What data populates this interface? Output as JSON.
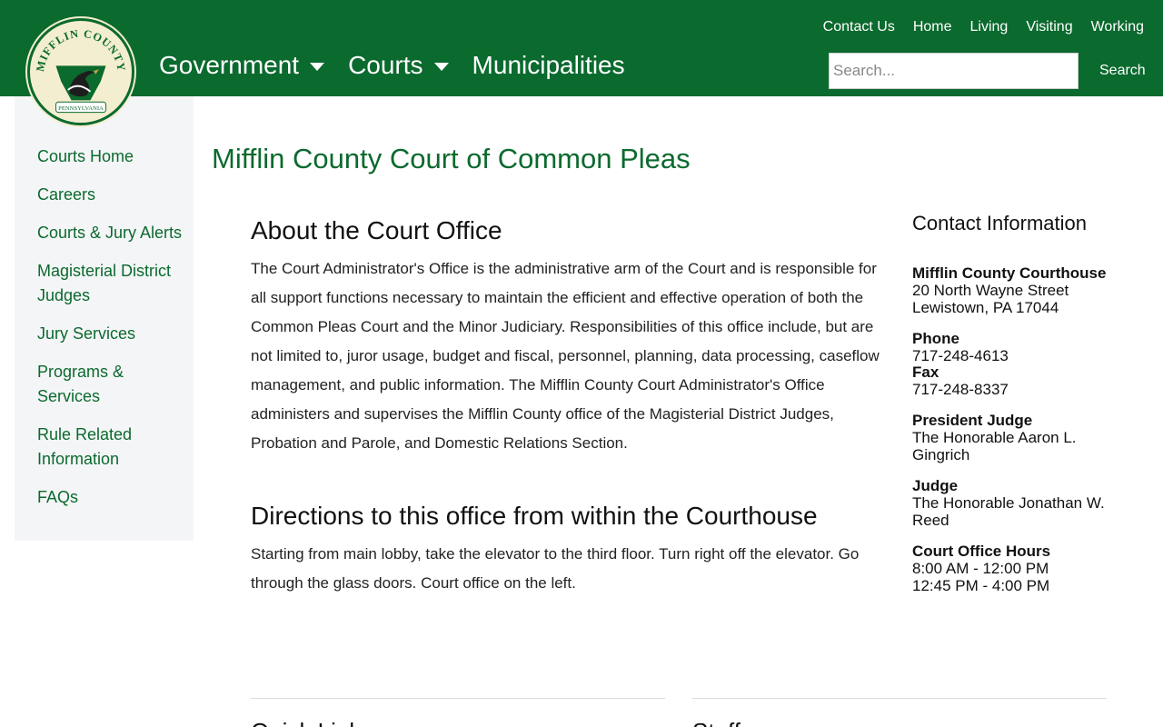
{
  "header": {
    "logo": {
      "top_text": "MIFFLIN COUNTY",
      "banner_text": "PENNSYLVANIA",
      "icon": "keystone-goose-seal"
    },
    "utility_nav": [
      "Contact Us",
      "Home",
      "Living",
      "Visiting",
      "Working"
    ],
    "main_nav": [
      {
        "label": "Government",
        "has_dropdown": true
      },
      {
        "label": "Courts",
        "has_dropdown": true
      },
      {
        "label": "Municipalities",
        "has_dropdown": false
      }
    ],
    "search": {
      "placeholder": "Search...",
      "button_label": "Search"
    }
  },
  "sidebar": {
    "items": [
      {
        "label": "Courts Home"
      },
      {
        "label": "Careers"
      },
      {
        "label": "Courts & Jury Alerts"
      },
      {
        "label": "Magisterial District Judges"
      },
      {
        "label": "Jury Services"
      },
      {
        "label": "Programs & Services"
      },
      {
        "label": "Rule Related Information"
      },
      {
        "label": "FAQs"
      }
    ]
  },
  "page": {
    "title": "Mifflin County Court of Common Pleas",
    "about_heading": "About the Court Office",
    "about_text": "The Court Administrator's Office is the administrative arm of the Court and is responsible for all support functions necessary to maintain the efficient and effective operation of both the Common Pleas Court and the Minor Judiciary. Responsibilities of this office include, but are not limited to, juror usage, budget and fiscal, personnel, planning, data processing, caseflow management, and public information. The Mifflin County Court Administrator's Office administers and supervises the Mifflin County office of the Magisterial District Judges, Probation and Parole, and Domestic Relations Section.",
    "directions_heading": "Directions to this office from within the Courthouse",
    "directions_text": "Starting from main lobby, take the elevator to the third floor. Turn right off the elevator. Go through the glass doors. Court office on the left.",
    "bottom_headings": [
      "Quick Links",
      "Staff"
    ]
  },
  "contact": {
    "heading": "Contact Information",
    "location_label": "Mifflin County Courthouse",
    "address_line1": "20 North Wayne Street",
    "address_line2": "Lewistown, PA 17044",
    "phone_label": "Phone",
    "phone": "717-248-4613",
    "fax_label": "Fax",
    "fax": "717-248-8337",
    "president_judge_label": "President Judge",
    "president_judge": "The Honorable Aaron L. Gingrich",
    "judge_label": "Judge",
    "judge": "The Honorable Jonathan W. Reed",
    "hours_label": "Court Office Hours",
    "hours_line1": "8:00 AM - 12:00 PM",
    "hours_line2": "12:45 PM - 4:00 PM"
  },
  "colors": {
    "brand_green": "#0b6a2e",
    "sidebar_bg": "#f4f5f7",
    "logo_bg": "#f3eecf"
  }
}
